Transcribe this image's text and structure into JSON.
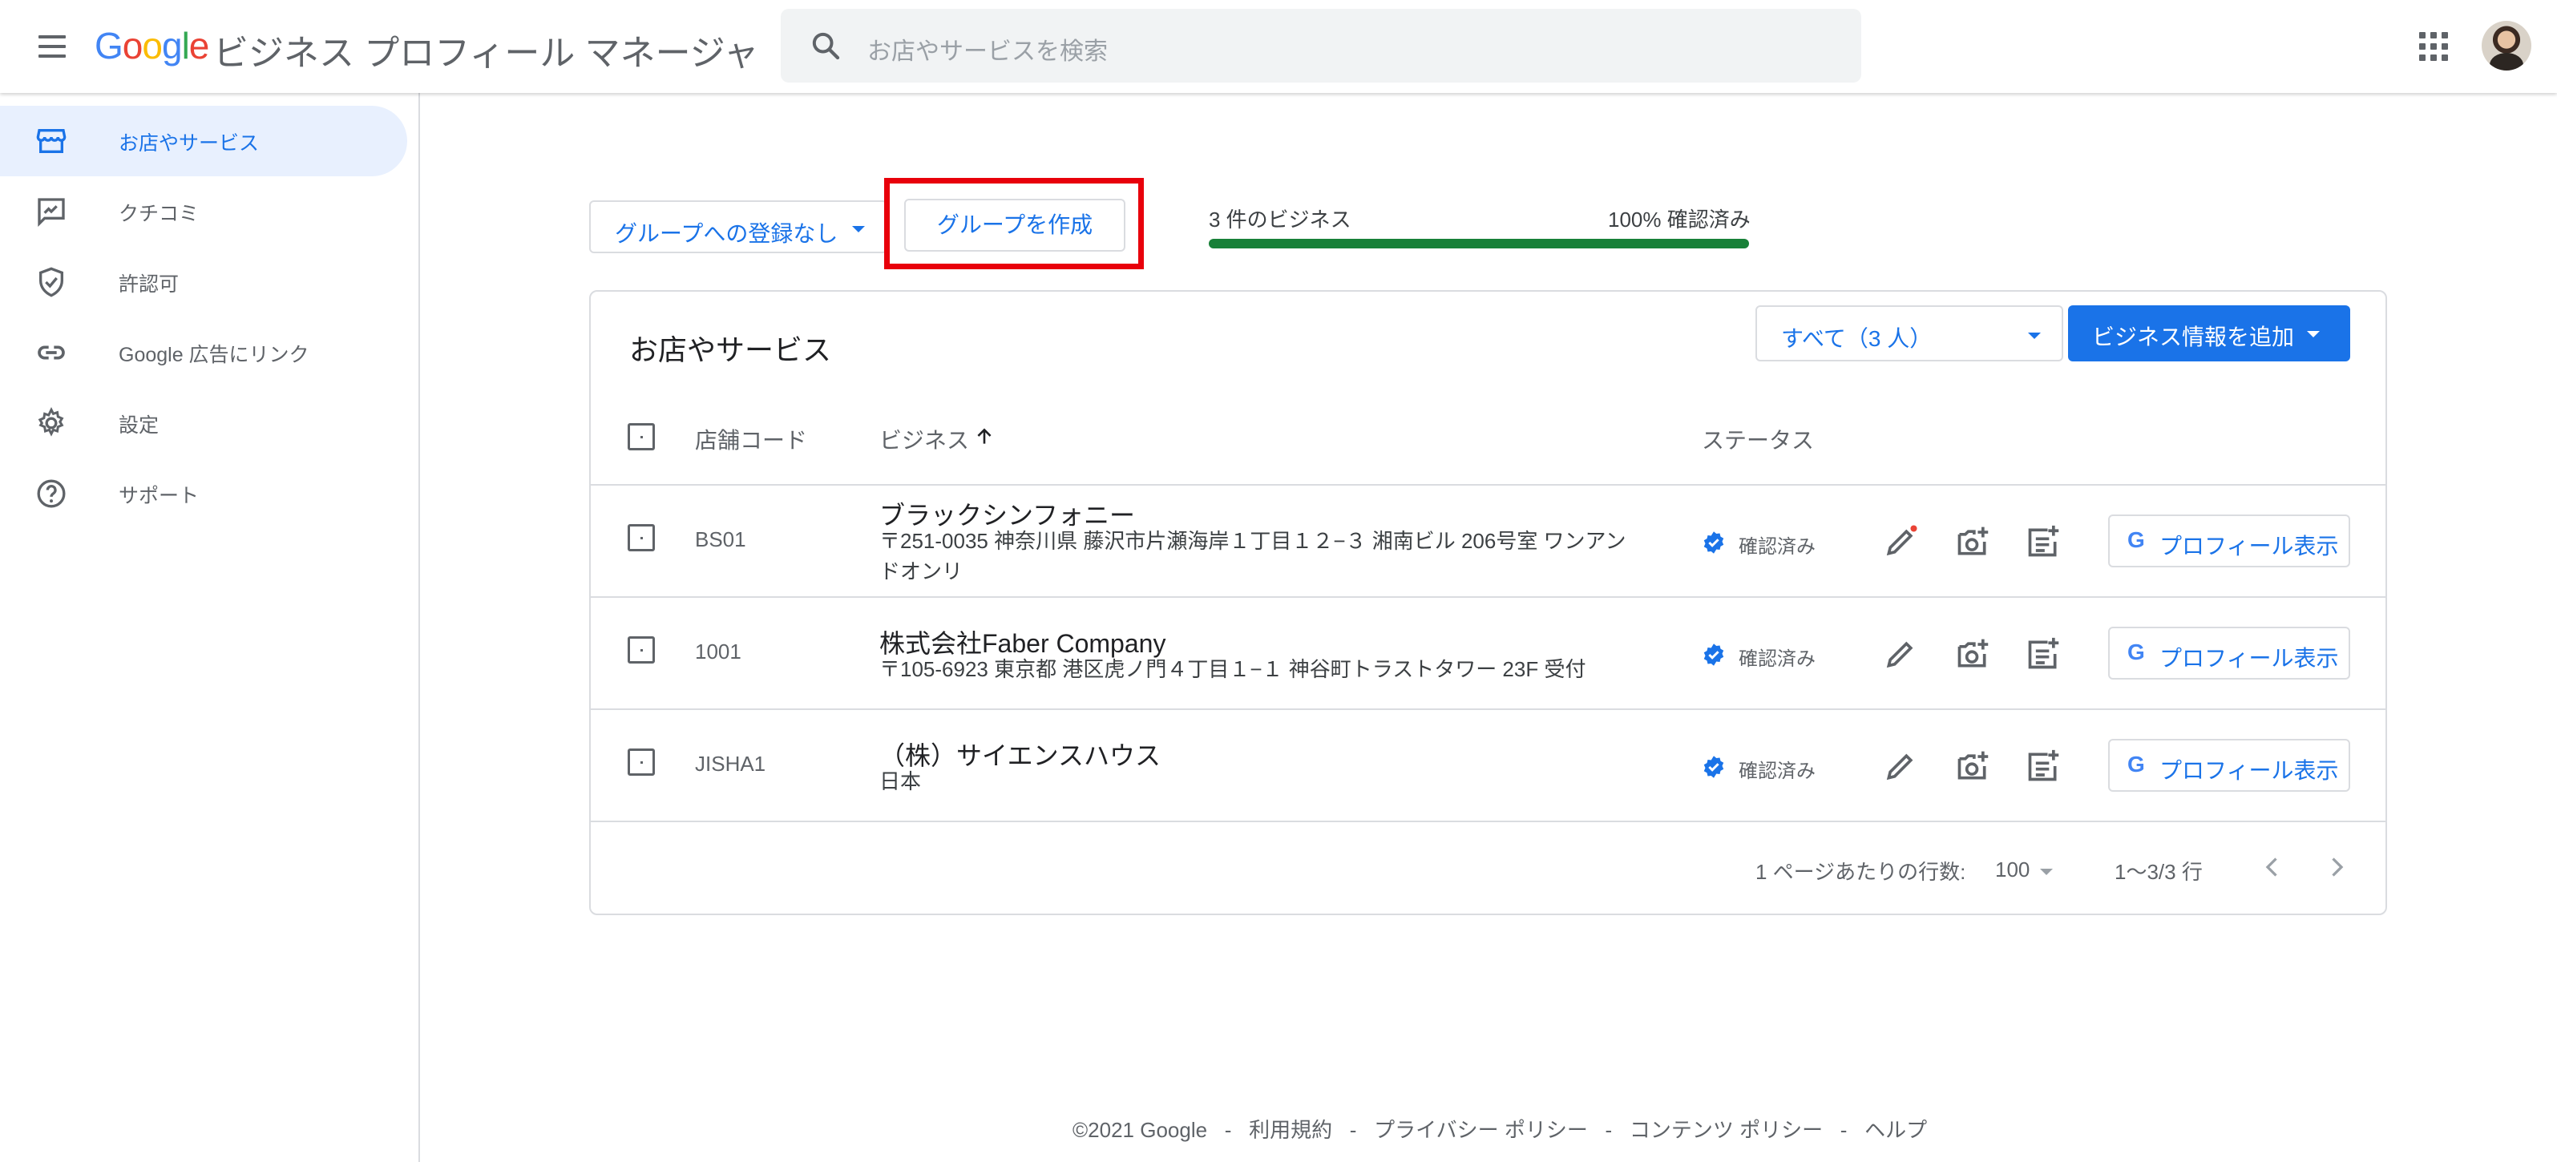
{
  "header": {
    "logo": {
      "G": "G",
      "o1": "o",
      "o2": "o",
      "g": "g",
      "l": "l",
      "e": "e"
    },
    "product_name": "ビジネス プロフィール マネージャ",
    "search_placeholder": "お店やサービスを検索"
  },
  "sidebar": {
    "items": [
      {
        "label": "お店やサービス",
        "icon": "storefront-icon",
        "active": true
      },
      {
        "label": "クチコミ",
        "icon": "review-icon",
        "active": false
      },
      {
        "label": "許認可",
        "icon": "verified-shield-icon",
        "active": false
      },
      {
        "label": "Google 広告にリンク",
        "icon": "link-icon",
        "active": false
      },
      {
        "label": "設定",
        "icon": "gear-icon",
        "active": false
      },
      {
        "label": "サポート",
        "icon": "help-icon",
        "active": false
      }
    ]
  },
  "toolbar": {
    "group_select": "グループへの登録なし",
    "create_group": "グループを作成",
    "business_count": "3 件のビジネス",
    "verified_percent": "100% 確認済み",
    "verified_fraction": 1.0
  },
  "card": {
    "title": "お店やサービス",
    "filter": "すべて（3 人）",
    "add_business": "ビジネス情報を追加",
    "columns": {
      "code": "店舗コード",
      "business": "ビジネス",
      "status": "ステータス"
    },
    "rows": [
      {
        "code": "BS01",
        "name": "ブラックシンフォニー",
        "address_line1": "〒251-0035 神奈川県 藤沢市片瀬海岸１丁目１２−３ 湘南ビル 206号室 ワンアン",
        "address_line2": "ドオンリ",
        "status": "確認済み",
        "edit_has_alert": true
      },
      {
        "code": "1001",
        "name": "株式会社Faber Company",
        "address_line1": "〒105-6923 東京都 港区虎ノ門４丁目１−１ 神谷町トラストタワー 23F 受付",
        "address_line2": "",
        "status": "確認済み",
        "edit_has_alert": false
      },
      {
        "code": "JISHA1",
        "name": "（株）サイエンスハウス",
        "address_line1": "日本",
        "address_line2": "",
        "status": "確認済み",
        "edit_has_alert": false
      }
    ],
    "profile_button": "プロフィール表示",
    "pagination": {
      "rows_per_page_label": "1 ページあたりの行数:",
      "rows_per_page": "100",
      "range": "1～3/3 行"
    }
  },
  "footer": {
    "copyright": "©2021 Google",
    "sep": "-",
    "terms": "利用規約",
    "privacy": "プライバシー ポリシー",
    "content_policy": "コンテンツ ポリシー",
    "help": "ヘルプ"
  },
  "colors": {
    "accent": "#1a73e8",
    "verified": "#188038",
    "highlight": "#e8000b"
  }
}
